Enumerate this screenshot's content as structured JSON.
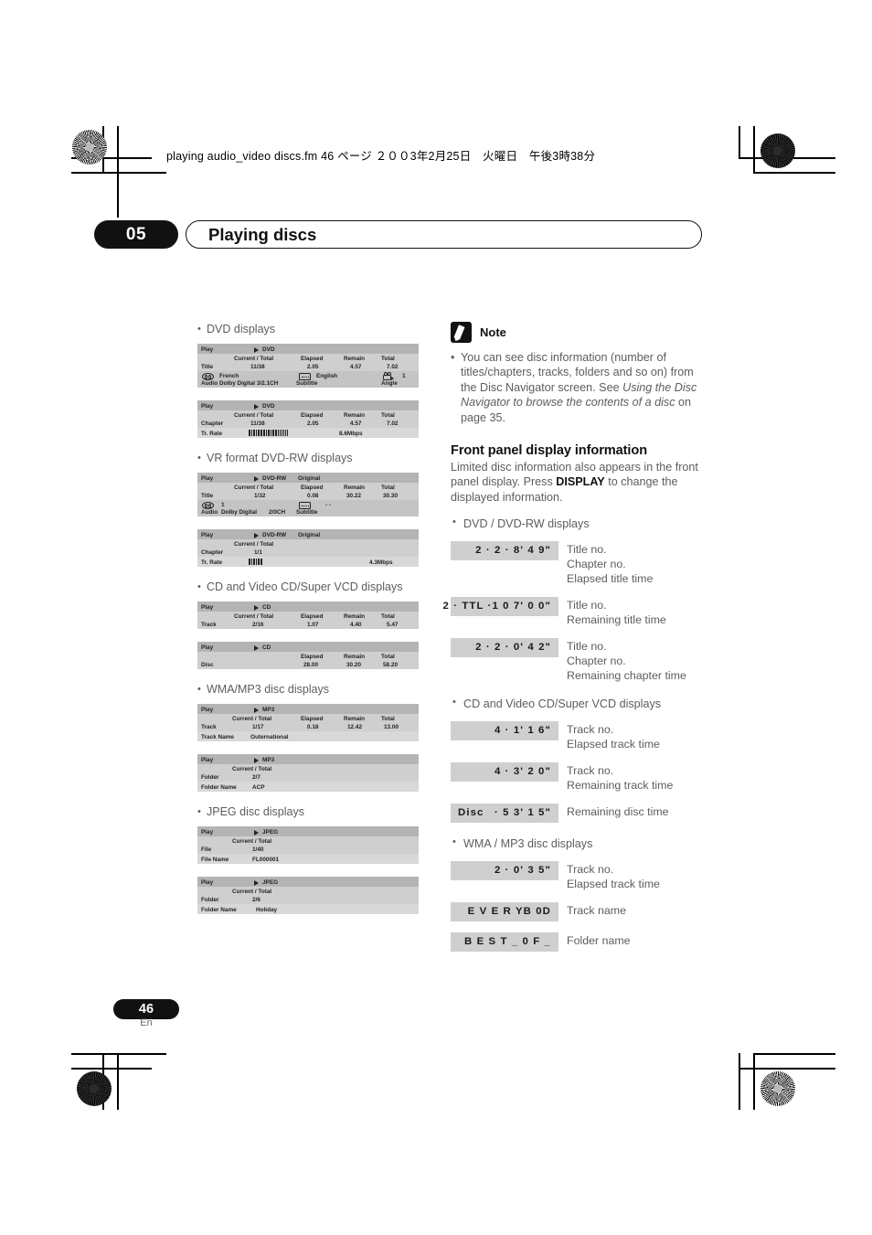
{
  "header": {
    "filename_line": "playing audio_video discs.fm 46 ページ ２００3年2月25日　火曜日　午後3時38分"
  },
  "chapter": {
    "number": "05",
    "title": "Playing discs"
  },
  "footer": {
    "page_number": "46",
    "language": "En"
  },
  "left_column": {
    "sections": [
      {
        "heading": "DVD displays"
      },
      {
        "heading": "VR format DVD-RW displays"
      },
      {
        "heading": "CD and Video CD/Super VCD displays"
      },
      {
        "heading": "WMA/MP3 disc displays"
      },
      {
        "heading": "JPEG disc displays"
      }
    ],
    "osd_dvd_title": {
      "play": "Play",
      "disc_type": "DVD",
      "col_current_total": "Current / Total",
      "col_elapsed": "Elapsed",
      "col_remain": "Remain",
      "col_total": "Total",
      "row_label": "Title",
      "current_total": "11/38",
      "elapsed": "2.05",
      "remain": "4.57",
      "total": "7.02",
      "audio_label": "Audio",
      "audio_lang": "French",
      "audio_format": "Dolby Digital 3/2.1CH",
      "subtitle_label": "Subtitle",
      "subtitle_lang": "English",
      "angle_label": "Angle",
      "angle_value": "1"
    },
    "osd_dvd_chapter": {
      "play": "Play",
      "disc_type": "DVD",
      "col_current_total": "Current / Total",
      "col_elapsed": "Elapsed",
      "col_remain": "Remain",
      "col_total": "Total",
      "row_label": "Chapter",
      "current_total": "11/38",
      "elapsed": "2.05",
      "remain": "4.57",
      "total": "7.02",
      "tr_rate_label": "Tr. Rate",
      "tr_rate_value": "8.6Mbps"
    },
    "osd_dvdrw_title": {
      "play": "Play",
      "disc_type": "DVD-RW",
      "disc_mode": "Original",
      "col_current_total": "Current / Total",
      "col_elapsed": "Elapsed",
      "col_remain": "Remain",
      "col_total": "Total",
      "row_label": "Title",
      "current_total": "1/32",
      "elapsed": "0.08",
      "remain": "30.22",
      "total": "30.30",
      "audio_label": "Audio",
      "audio_num": "1",
      "audio_format": "Dolby Digital",
      "audio_channels": "2/0CH",
      "subtitle_label": "Subtitle",
      "subtitle_value": "- -"
    },
    "osd_dvdrw_chapter": {
      "play": "Play",
      "disc_type": "DVD-RW",
      "disc_mode": "Original",
      "col_current_total": "Current / Total",
      "row_label": "Chapter",
      "current_total": "1/1",
      "tr_rate_label": "Tr. Rate",
      "tr_rate_value": "4.3Mbps"
    },
    "osd_cd_track": {
      "play": "Play",
      "disc_type": "CD",
      "col_current_total": "Current / Total",
      "col_elapsed": "Elapsed",
      "col_remain": "Remain",
      "col_total": "Total",
      "row_label": "Track",
      "current_total": "2/16",
      "elapsed": "1.07",
      "remain": "4.40",
      "total": "5.47"
    },
    "osd_cd_disc": {
      "play": "Play",
      "disc_type": "CD",
      "col_elapsed": "Elapsed",
      "col_remain": "Remain",
      "col_total": "Total",
      "row_label": "Disc",
      "elapsed": "28.00",
      "remain": "30.20",
      "total": "58.20"
    },
    "osd_mp3_track": {
      "play": "Play",
      "disc_type": "MP3",
      "col_current_total": "Current / Total",
      "col_elapsed": "Elapsed",
      "col_remain": "Remain",
      "col_total": "Total",
      "row_label": "Track",
      "current_total": "1/17",
      "elapsed": "0.18",
      "remain": "12.42",
      "total": "13.00",
      "name_label": "Track Name",
      "name_value": "Outernational"
    },
    "osd_mp3_folder": {
      "play": "Play",
      "disc_type": "MP3",
      "col_current_total": "Current / Total",
      "row_label": "Folder",
      "current_total": "2/7",
      "name_label": "Folder Name",
      "name_value": "ACP"
    },
    "osd_jpeg_file": {
      "play": "Play",
      "disc_type": "JPEG",
      "col_current_total": "Current / Total",
      "row_label": "File",
      "current_total": "1/40",
      "name_label": "File Name",
      "name_value": "FL000001"
    },
    "osd_jpeg_folder": {
      "play": "Play",
      "disc_type": "JPEG",
      "col_current_total": "Current / Total",
      "row_label": "Folder",
      "current_total": "2/6",
      "name_label": "Folder Name",
      "name_value": "Holiday"
    }
  },
  "right_column": {
    "note": {
      "label": "Note",
      "text_part1": "You can see disc information (number of titles/chapters, tracks, folders and so on) from the Disc Navigator screen. See ",
      "text_italic": "Using the Disc Navigator to browse the contents of a disc",
      "text_part2": " on page 35."
    },
    "front_panel": {
      "heading": "Front panel display information",
      "body_part1": "Limited disc information also appears in the front panel display. Press ",
      "body_bold": "DISPLAY",
      "body_part2": " to change the displayed information.",
      "groups": [
        {
          "bullet": "DVD / DVD-RW displays",
          "rows": [
            {
              "display": "2 ·    2 ·     8' 4 9\"",
              "labels": [
                "Title no.",
                "Chapter no.",
                "Elapsed title time"
              ]
            },
            {
              "display": "2 · TTL  ·1 0 7' 0 0\"",
              "labels": [
                "Title no.",
                "Remaining title time"
              ]
            },
            {
              "display": "2 ·    2 ·     0' 4 2\"",
              "labels": [
                "Title no.",
                "Chapter no.",
                "Remaining chapter time"
              ]
            }
          ]
        },
        {
          "bullet": "CD and Video CD/Super VCD displays",
          "rows": [
            {
              "display": "4 ·      1' 1 6\"",
              "labels": [
                "Track no.",
                "Elapsed track time"
              ]
            },
            {
              "display": "4 ·      3' 2 0\"",
              "labels": [
                "Track no.",
                "Remaining track time"
              ]
            },
            {
              "display_lead": "Disc",
              "display": "·   5 3' 1 5\"",
              "labels": [
                "Remaining disc time"
              ]
            }
          ]
        },
        {
          "bullet": "WMA / MP3 disc displays",
          "rows": [
            {
              "display": "2 ·      0' 3 5\"",
              "labels": [
                "Track no.",
                "Elapsed track time"
              ]
            },
            {
              "display": "E V E  R YB 0D",
              "labels": [
                "Track name"
              ]
            },
            {
              "display": "B E S T _ 0 F _",
              "labels": [
                "Folder name"
              ]
            }
          ]
        }
      ]
    }
  }
}
